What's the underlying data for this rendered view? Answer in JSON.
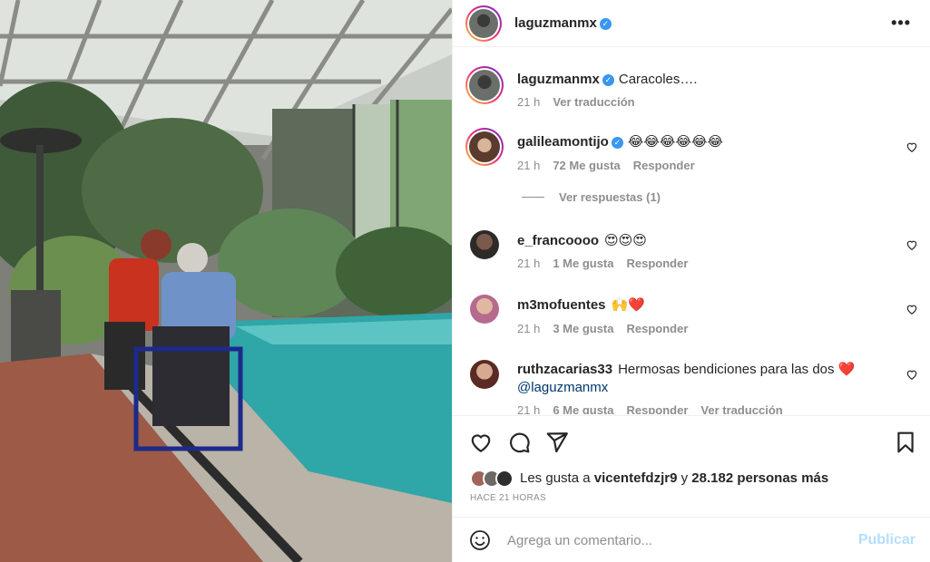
{
  "post": {
    "author": "laguzmanmx",
    "photo_alt_icon": "photo-image"
  },
  "caption": {
    "username": "laguzmanmx",
    "text": "Caracoles….",
    "time": "21 h",
    "translate": "Ver traducción"
  },
  "comments": [
    {
      "username": "galileamontijo",
      "text": "😂😂😂😂😂😂",
      "time": "21 h",
      "likes": "72 Me gusta",
      "reply": "Responder"
    },
    {
      "username": "e_francoooo",
      "text": "😍😍😍",
      "time": "21 h",
      "likes": "1 Me gusta",
      "reply": "Responder"
    },
    {
      "username": "m3mofuentes",
      "text": "🙌❤️",
      "time": "21 h",
      "likes": "3 Me gusta",
      "reply": "Responder"
    },
    {
      "username": "ruthzacarias33",
      "text": "Hermosas bendiciones para las dos ❤️",
      "mention": "@laguzmanmx",
      "time": "21 h",
      "likes": "6 Me gusta",
      "reply": "Responder",
      "translate": "Ver traducción"
    }
  ],
  "view_replies": "Ver respuestas (1)",
  "likes_summary": {
    "prefix": "Les gusta a ",
    "user": "vicentefdzjr9",
    "middle": " y ",
    "count": "28.182 personas más"
  },
  "time_ago": "HACE 21 HORAS",
  "add_comment": {
    "placeholder": "Agrega un comentario...",
    "post_label": "Publicar"
  },
  "colors": {
    "verified": "#3897f0",
    "link": "#00376b",
    "post_disabled": "#b2dffc",
    "secondary_text": "#8e8e8e"
  }
}
